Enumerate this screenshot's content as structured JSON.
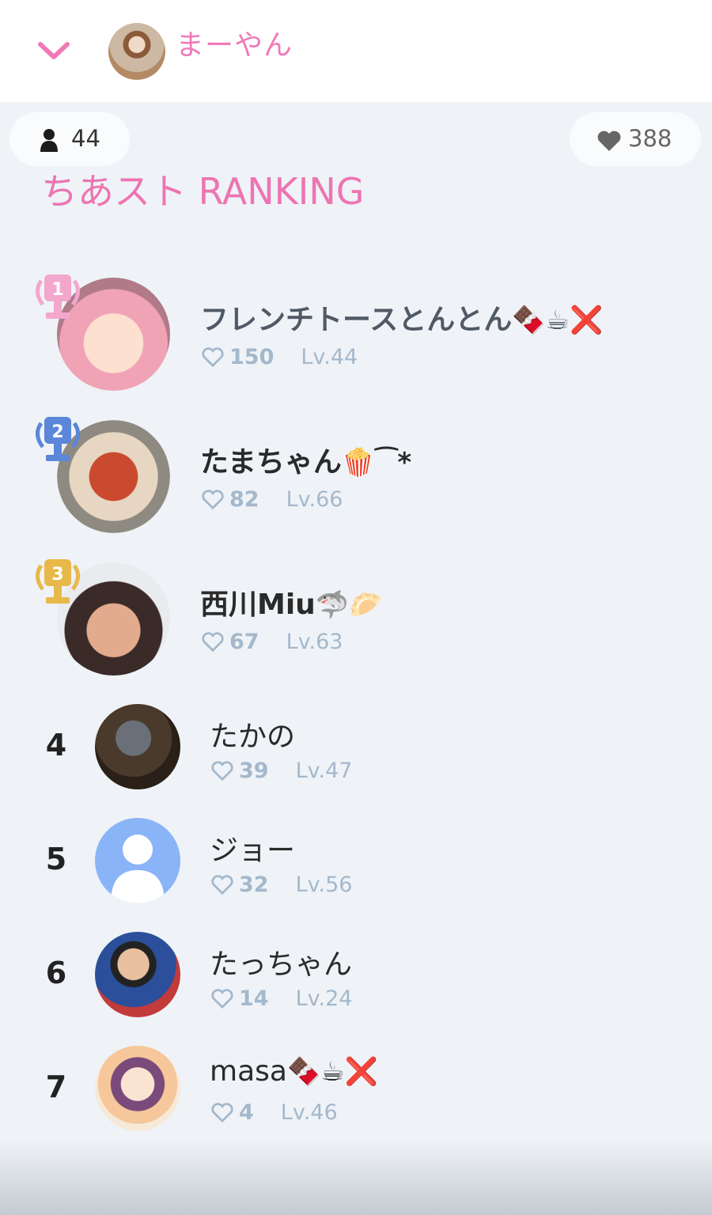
{
  "header": {
    "host_name": "まーやん"
  },
  "stats": {
    "viewers": "44",
    "likes": "388"
  },
  "title": "ちあスト RANKING",
  "ranking": [
    {
      "rank": "1",
      "name": "フレンチトースとんとん",
      "emoji": "🍫☕❌",
      "likes": "150",
      "level": "Lv.44"
    },
    {
      "rank": "2",
      "name": "たまちゃん",
      "emoji": "🍿⁀*",
      "likes": "82",
      "level": "Lv.66"
    },
    {
      "rank": "3",
      "name": "西川Miu",
      "emoji": "🦈🥟",
      "likes": "67",
      "level": "Lv.63"
    },
    {
      "rank": "4",
      "name": "たかの",
      "emoji": "",
      "likes": "39",
      "level": "Lv.47"
    },
    {
      "rank": "5",
      "name": "ジョー",
      "emoji": "",
      "likes": "32",
      "level": "Lv.56"
    },
    {
      "rank": "6",
      "name": "たっちゃん",
      "emoji": "",
      "likes": "14",
      "level": "Lv.24"
    },
    {
      "rank": "7",
      "name": "masa",
      "emoji": "🍫☕❌",
      "likes": "4",
      "level": "Lv.46"
    }
  ],
  "colors": {
    "accent_pink": "#f07ab8",
    "gold": "#e8b84a",
    "silver_pink": "#f3a7cd",
    "blue": "#5b86d9",
    "muted": "#a4b8cc"
  }
}
